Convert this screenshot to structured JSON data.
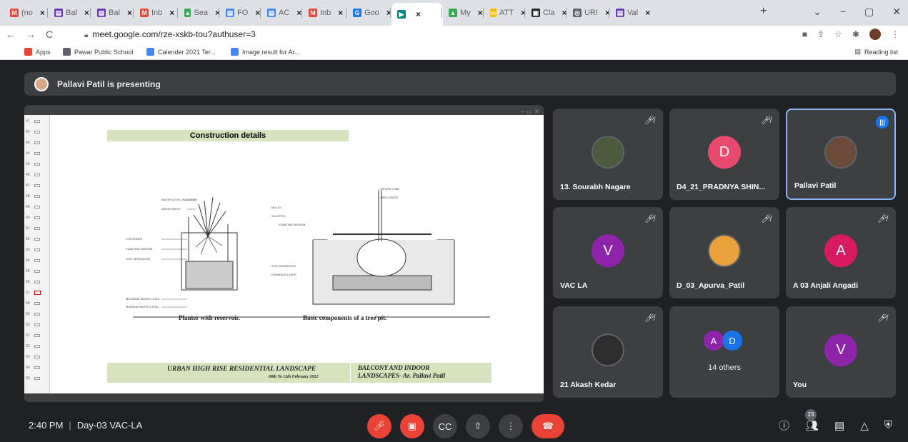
{
  "browser": {
    "tabs": [
      {
        "label": "(no",
        "icon": "gmail-icon",
        "color": "#ea4335",
        "glyph": "M"
      },
      {
        "label": "Bal",
        "icon": "docs-icon",
        "color": "#673ab7",
        "glyph": "▤"
      },
      {
        "label": "Bal",
        "icon": "docs-icon",
        "color": "#673ab7",
        "glyph": "▤"
      },
      {
        "label": "Inb",
        "icon": "gmail-icon",
        "color": "#ea4335",
        "glyph": "M"
      },
      {
        "label": "Sea",
        "icon": "drive-icon",
        "color": "#34a853",
        "glyph": "▲"
      },
      {
        "label": "FO",
        "icon": "docs-icon",
        "color": "#4285f4",
        "glyph": "▤"
      },
      {
        "label": "AC",
        "icon": "docs-icon",
        "color": "#4285f4",
        "glyph": "▤"
      },
      {
        "label": "Inb",
        "icon": "gmail-icon",
        "color": "#ea4335",
        "glyph": "M"
      },
      {
        "label": "Goo",
        "icon": "classroom-icon",
        "color": "#1a73e8",
        "glyph": "G"
      },
      {
        "label": "",
        "icon": "meet-icon",
        "color": "#00897b",
        "glyph": "▶"
      },
      {
        "label": "My",
        "icon": "drive-icon",
        "color": "#34a853",
        "glyph": "▲"
      },
      {
        "label": "ATT",
        "icon": "slides-icon",
        "color": "#fbbc04",
        "glyph": "▭"
      },
      {
        "label": "Cla",
        "icon": "classroom-icon",
        "color": "#202124",
        "glyph": "▣"
      },
      {
        "label": "URI",
        "icon": "globe-icon",
        "color": "#5f6368",
        "glyph": "◎"
      },
      {
        "label": "Val",
        "icon": "forms-icon",
        "color": "#673ab7",
        "glyph": "▤"
      }
    ],
    "url": "meet.google.com/rze-xskb-tou?authuser=3",
    "bookmarks": [
      {
        "label": "Apps",
        "icon": "apps-grid-icon",
        "color": "#ea4335"
      },
      {
        "label": "Pawar Public School",
        "icon": "globe-icon",
        "color": "#5f6368"
      },
      {
        "label": "Calender 2021 Ter...",
        "icon": "docs-icon",
        "color": "#4285f4"
      },
      {
        "label": "Image result for Ar...",
        "icon": "google-icon",
        "color": "#4285f4"
      }
    ],
    "reading_list": "Reading list"
  },
  "meet": {
    "presenting_text": "Pallavi Patil is presenting",
    "slide": {
      "title": "Construction details",
      "caption_left": "Planter with reservoir.",
      "caption_right": "Basic components of a tree pit.",
      "footer_left": "URBAN HIGH RISE RESIDENTIAL LANDSCAPE",
      "footer_date": "08th To 12th February 2022",
      "footer_right_1": "BALCONY AND INDOOR",
      "footer_right_2": "LANDSCAPES- Ar. Pallavi Patil",
      "labels_left": [
        "WATER LEVEL INDICATOR",
        "WATER INPUT",
        "CONTAINER",
        "PLANTING MEDIUM",
        "SOIL SEPARATOR",
        "MAXIMUM WATER LEVEL",
        "MINIMUM WATER LEVEL"
      ],
      "labels_right": [
        "SIPHON TUBE",
        "TREE GRATE",
        "MULCH",
        "SCUPPER",
        "PLANTING MEDIUM",
        "SOIL SEPARATOR",
        "DRAINAGE LAYER"
      ],
      "thumb_numbers": [
        "41",
        "42",
        "43",
        "44",
        "45",
        "46",
        "47",
        "48",
        "49",
        "50",
        "51",
        "52",
        "53",
        "54",
        "55",
        "56",
        "57",
        "58",
        "59",
        "60",
        "61",
        "62",
        "63",
        "64",
        "65"
      ]
    },
    "participants": [
      {
        "name": "13. Sourabh Nagare",
        "initial": "",
        "color": "#4a5a3a",
        "photo": true
      },
      {
        "name": "D4_21_PRADNYA SHIN...",
        "initial": "D",
        "color": "#e84a6f"
      },
      {
        "name": "Pallavi Patil",
        "initial": "",
        "color": "#6b4a3a",
        "photo": true,
        "active": true
      },
      {
        "name": "VAC LA",
        "initial": "V",
        "color": "#8e24aa"
      },
      {
        "name": "D_03_Apurva_Patil",
        "initial": "",
        "color": "#e9a23b",
        "photo": true
      },
      {
        "name": "A 03 Anjali Angadi",
        "initial": "A",
        "color": "#d81b60"
      },
      {
        "name": "21 Akash Kedar",
        "initial": "",
        "color": "#2d2d2d",
        "photo": true
      },
      {
        "name": "14 others",
        "initial": "",
        "others": true
      },
      {
        "name": "You",
        "initial": "V",
        "color": "#8e24aa"
      }
    ],
    "others_initials": [
      "A",
      "D"
    ],
    "others_colors": [
      "#8e24aa",
      "#1a73e8"
    ],
    "time": "2:40 PM",
    "meeting_name": "Day-03 VAC-LA",
    "people_count": "23"
  }
}
